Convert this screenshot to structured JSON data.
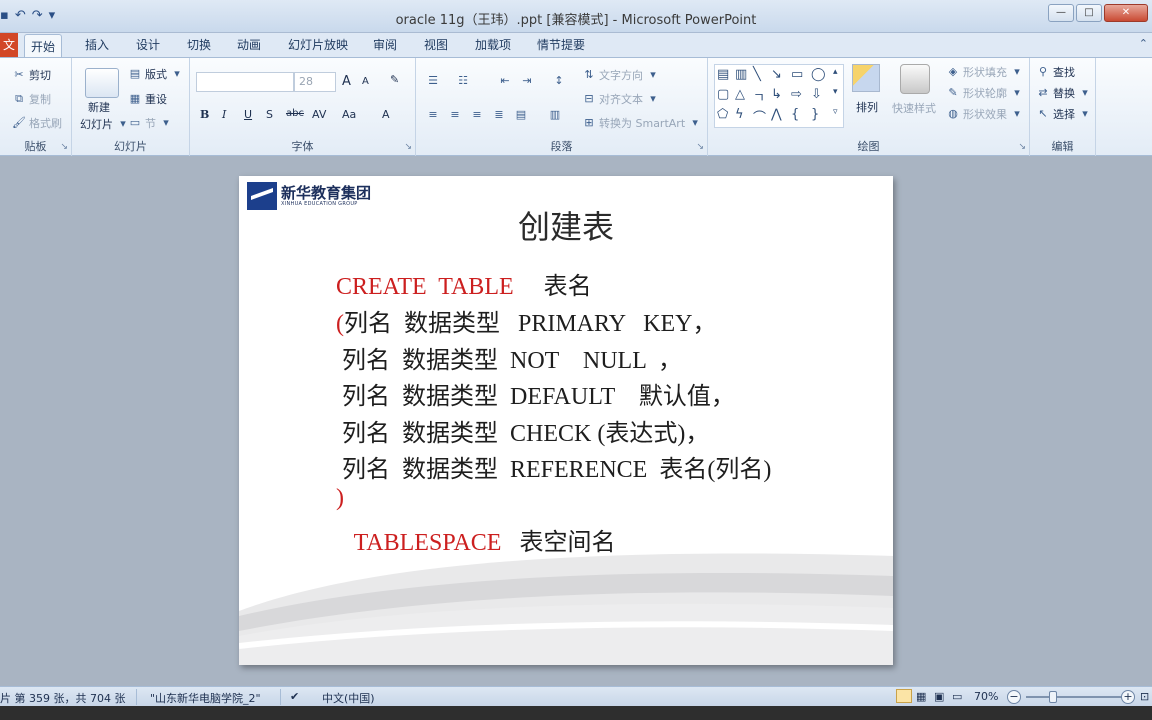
{
  "window": {
    "title": "oracle 11g（王玮）.ppt [兼容模式] - Microsoft PowerPoint",
    "controls": {
      "minimize": "—",
      "maximize": "□",
      "close": "✕"
    }
  },
  "quick_access": {
    "save_icon": "save-icon",
    "undo_icon": "undo-icon",
    "redo_icon": "redo-icon"
  },
  "tabs": {
    "file": "文",
    "items": [
      "开始",
      "插入",
      "设计",
      "切换",
      "动画",
      "幻灯片放映",
      "审阅",
      "视图",
      "加载项",
      "情节提要"
    ],
    "active": "开始"
  },
  "ribbon": {
    "clipboard": {
      "label": "贴板",
      "cut": "剪切",
      "copy": "复制",
      "format_painter": "格式刷"
    },
    "slides": {
      "label": "幻灯片",
      "new_slide_1": "新建",
      "new_slide_2": "幻灯片",
      "layout": "版式",
      "reset": "重设",
      "section": "节"
    },
    "font": {
      "label": "字体",
      "font_name": "",
      "font_size": "28",
      "bold": "B",
      "italic": "I",
      "underline": "U",
      "shadow": "S",
      "strike": "abc",
      "spacing": "AV",
      "case": "Aa",
      "color": "A",
      "grow": "A",
      "shrink": "A"
    },
    "paragraph": {
      "label": "段落",
      "text_direction": "文字方向",
      "align_text": "对齐文本",
      "smartart": "转换为 SmartArt"
    },
    "drawing": {
      "label": "绘图",
      "arrange": "排列",
      "quick_styles": "快速样式",
      "shape_fill": "形状填充",
      "shape_outline": "形状轮廓",
      "shape_effects": "形状效果"
    },
    "editing": {
      "label": "编辑",
      "find": "查找",
      "replace": "替换",
      "select": "选择"
    }
  },
  "slide": {
    "logo": {
      "cn": "新华教育集团",
      "en": "XINHUA EDUCATION GROUP"
    },
    "title": "创建表",
    "lines": [
      {
        "red": "CREATE  TABLE",
        "black": "     表名"
      },
      {
        "red": "(",
        "black": "列名  数据类型   PRIMARY   KEY，"
      },
      {
        "red": "",
        "black": " 列名  数据类型  NOT    NULL  ，"
      },
      {
        "red": "",
        "black": " 列名  数据类型  DEFAULT    默认值，"
      },
      {
        "red": "",
        "black": " 列名  数据类型  CHECK (表达式)，"
      },
      {
        "red": "",
        "black": " 列名  数据类型  REFERENCE  表名(列名)"
      },
      {
        "red": ")",
        "black": ""
      },
      {
        "red": "   TABLESPACE",
        "black": "   表空间名"
      }
    ]
  },
  "status": {
    "slide_info": "片 第 359 张，共 704 张",
    "theme": "\"山东新华电脑学院_2\"",
    "language": "中文(中国)",
    "zoom": "70%",
    "zoom_fraction": 0.28
  }
}
